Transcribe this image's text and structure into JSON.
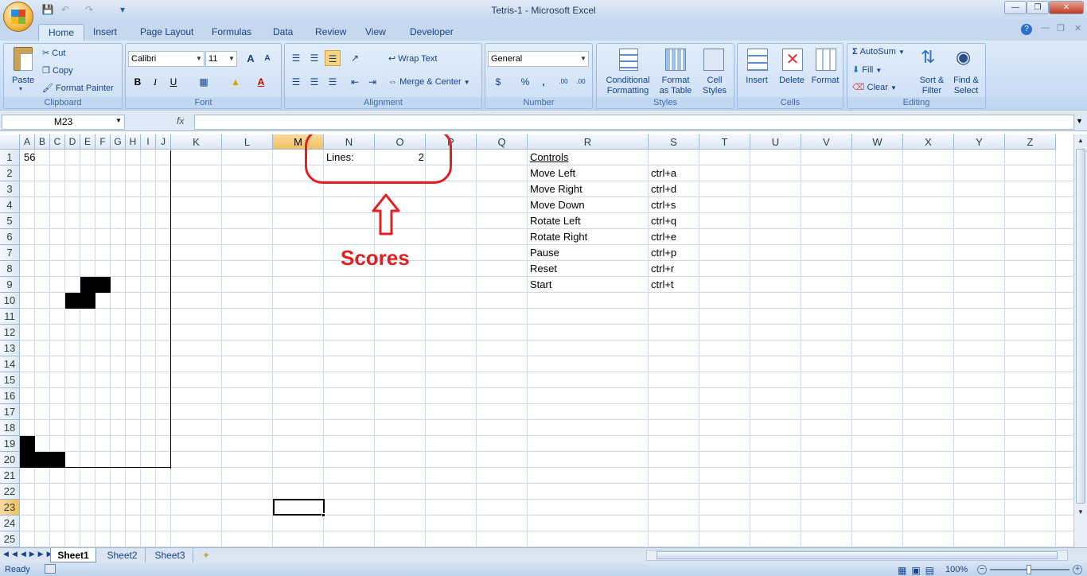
{
  "window": {
    "title": "Tetris-1 - Microsoft Excel"
  },
  "tabs": [
    "Home",
    "Insert",
    "Page Layout",
    "Formulas",
    "Data",
    "Review",
    "View",
    "Developer"
  ],
  "active_tab": "Home",
  "ribbon": {
    "clipboard": {
      "label": "Clipboard",
      "paste": "Paste",
      "cut": "Cut",
      "copy": "Copy",
      "format_painter": "Format Painter"
    },
    "font": {
      "label": "Font",
      "family": "Calibri",
      "size": "11",
      "bold": "B",
      "italic": "I",
      "underline": "U",
      "grow": "A",
      "shrink": "A",
      "font_color_letter": "A"
    },
    "alignment": {
      "label": "Alignment",
      "wrap_text": "Wrap Text",
      "merge_center": "Merge & Center"
    },
    "number": {
      "label": "Number",
      "format": "General",
      "currency": "$",
      "percent": "%",
      "comma": ",",
      "inc_decimal": ".00",
      "dec_decimal": ".00"
    },
    "styles": {
      "label": "Styles",
      "conditional_1": "Conditional",
      "conditional_2": "Formatting",
      "format_table_1": "Format",
      "format_table_2": "as Table",
      "cell_styles_1": "Cell",
      "cell_styles_2": "Styles"
    },
    "cells": {
      "label": "Cells",
      "insert": "Insert",
      "delete": "Delete",
      "format": "Format"
    },
    "editing": {
      "label": "Editing",
      "autosum": "AutoSum",
      "fill": "Fill",
      "clear": "Clear",
      "sort_1": "Sort &",
      "sort_2": "Filter",
      "find_1": "Find &",
      "find_2": "Select"
    }
  },
  "formula_bar": {
    "name_box": "M23",
    "fx": "fx",
    "value": ""
  },
  "columns": [
    "A",
    "B",
    "C",
    "D",
    "E",
    "F",
    "G",
    "H",
    "I",
    "J",
    "K",
    "L",
    "M",
    "N",
    "O",
    "P",
    "Q",
    "R",
    "S",
    "T",
    "U",
    "V",
    "W",
    "X",
    "Y",
    "Z"
  ],
  "selected_column": "M",
  "rows": [
    "1",
    "2",
    "3",
    "4",
    "5",
    "6",
    "7",
    "8",
    "9",
    "10",
    "11",
    "12",
    "13",
    "14",
    "15",
    "16",
    "17",
    "18",
    "19",
    "20",
    "21",
    "22",
    "23",
    "24",
    "25"
  ],
  "selected_row": "23",
  "cells": {
    "A1": "56",
    "N1": "Lines:",
    "O1": "2",
    "R1": "Controls"
  },
  "controls": [
    {
      "action": "Move Left",
      "key": "ctrl+a"
    },
    {
      "action": "Move Right",
      "key": "ctrl+d"
    },
    {
      "action": "Move Down",
      "key": "ctrl+s"
    },
    {
      "action": "Rotate Left",
      "key": "ctrl+q"
    },
    {
      "action": "Rotate Right",
      "key": "ctrl+e"
    },
    {
      "action": "Pause",
      "key": "ctrl+p"
    },
    {
      "action": "Reset",
      "key": "ctrl+r"
    },
    {
      "action": "Start",
      "key": "ctrl+t"
    }
  ],
  "annotation": {
    "label": "Scores",
    "color": "#e02020"
  },
  "game_blocks": [
    {
      "cell": "E9"
    },
    {
      "cell": "F9"
    },
    {
      "cell": "D10"
    },
    {
      "cell": "E10"
    },
    {
      "cell": "A19"
    },
    {
      "cell": "A20"
    },
    {
      "cell": "B20"
    },
    {
      "cell": "C20"
    }
  ],
  "sheet_tabs": [
    "Sheet1",
    "Sheet2",
    "Sheet3"
  ],
  "active_sheet": "Sheet1",
  "status": {
    "text": "Ready",
    "zoom": "100%"
  }
}
